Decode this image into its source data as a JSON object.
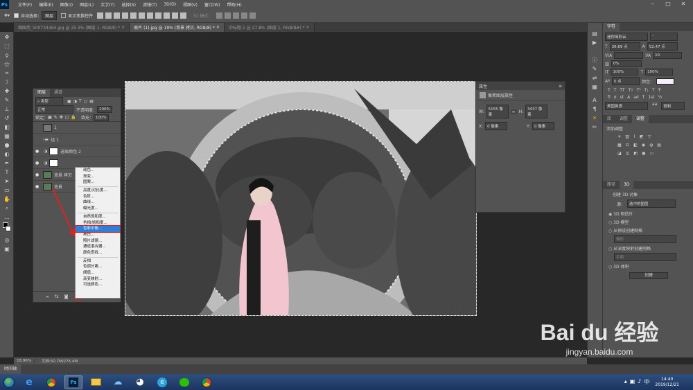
{
  "menubar": {
    "items": [
      "文件(F)",
      "编辑(E)",
      "图像(I)",
      "图层(L)",
      "文字(Y)",
      "选择(S)",
      "滤镜(T)",
      "3D(D)",
      "视图(V)",
      "窗口(W)",
      "帮助(H)"
    ]
  },
  "options": {
    "auto_select_label": "自动选择：",
    "auto_select_value": "图层",
    "show_transform_label": "显示变换控件",
    "mode_3d": "3D 模式："
  },
  "tabs": [
    "插图用_500734364.jpg @ 25.3% (图层 1, RGB/8) *",
    "原片 (1).jpg @ 19% (背景 拷贝, RGB/8) *",
    "中标题-1 @ 27.8% (图层 1, RGB/8#) *"
  ],
  "layers_panel": {
    "tabs": [
      "图层",
      "通道"
    ],
    "filter_label": "类型",
    "blend_mode": "正常",
    "opacity_label": "不透明度：",
    "opacity_value": "100%",
    "lock_label": "锁定：",
    "fill_label": "填充：",
    "fill_value": "100%",
    "layers": [
      {
        "name": "1",
        "type": "image"
      },
      {
        "name": "组 1",
        "type": "group"
      },
      {
        "name": "选取颜色 2",
        "type": "adjustment"
      },
      {
        "name": "",
        "type": "adjustment"
      },
      {
        "name": "背景 拷贝",
        "type": "image"
      },
      {
        "name": "背景",
        "type": "image"
      }
    ]
  },
  "context_menu": {
    "groups": [
      [
        "纯色...",
        "渐变...",
        "图案..."
      ],
      [
        "亮度/对比度...",
        "色阶...",
        "曲线...",
        "曝光度..."
      ],
      [
        "自然饱和度...",
        "色相/饱和度...",
        "色彩平衡...",
        "黑白...",
        "照片滤镜...",
        "通道混合器...",
        "颜色查找..."
      ],
      [
        "反相",
        "色调分离...",
        "阈值...",
        "渐变映射...",
        "可选颜色..."
      ]
    ],
    "highlighted": "色彩平衡..."
  },
  "properties_panel": {
    "title": "属性",
    "subtitle": "像素图层属性",
    "w_label": "W:",
    "w_value": "5155 像素",
    "h_label": "H:",
    "h_value": "3437 像素",
    "x_label": "X:",
    "x_value": "0 像素",
    "y_label": "Y:",
    "y_value": "0 像素"
  },
  "character_panel": {
    "title": "字符",
    "font": "迷你简彩云",
    "size": "36.69 点",
    "leading": "52.47 点",
    "kerning_label": "V/A",
    "tracking": "10",
    "scale_label": "0%",
    "vscale": "100%",
    "hscale": "100%",
    "baseline": "0 点",
    "color_label": "颜色：",
    "language": "美国英语",
    "aa": "锐利"
  },
  "adjust_panel": {
    "tabs": [
      "库",
      "调整",
      "调整"
    ],
    "add_label": "添加调整"
  },
  "panel_3d": {
    "tabs": [
      "路径",
      "3D"
    ],
    "create_label": "创建 3D 对象",
    "source_label": "源：",
    "source_value": "选中的图层",
    "options": [
      "3D 明信片",
      "3D 模型",
      "从预设创建网格",
      "从深度映射创建网格",
      "3D 体积"
    ],
    "preset_value": "锥形",
    "depth_value": "平面",
    "create_button": "创建"
  },
  "status": {
    "zoom": "18.96%",
    "doc": "文档:50.7M/276.4M"
  },
  "timeline_label": "时间轴",
  "clock": {
    "time": "14:40",
    "date": "2019/12/21"
  },
  "watermark": {
    "brand": "Bai du 经验",
    "url": "jingyan.baidu.com"
  }
}
